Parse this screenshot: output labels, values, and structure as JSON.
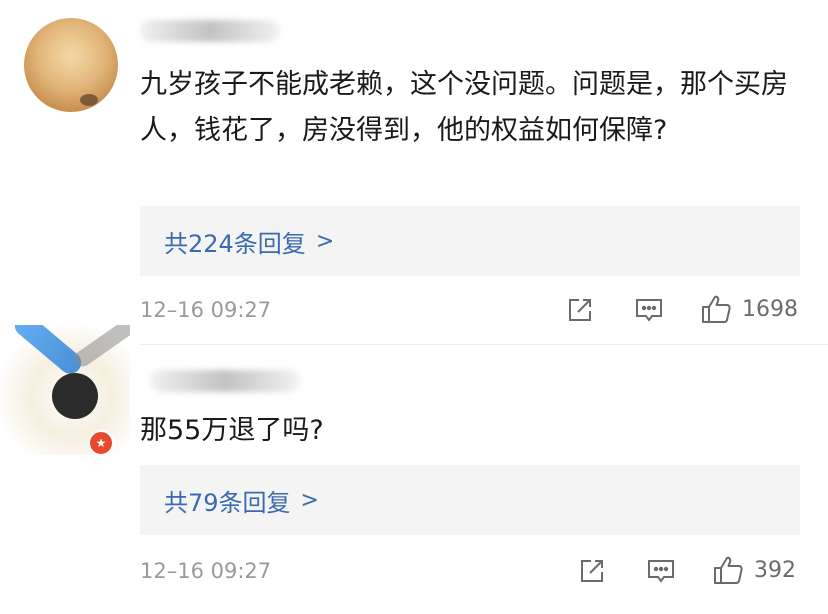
{
  "comments": [
    {
      "text": "九岁孩子不能成老赖，这个没问题。问题是，那个买房人，钱花了，房没得到，他的权益如何保障?",
      "replies_label": "共224条回复",
      "replies_chevron": ">",
      "timestamp": "12–16 09:27",
      "likes": "1698"
    },
    {
      "text": "那55万退了吗?",
      "replies_label": "共79条回复",
      "replies_chevron": ">",
      "timestamp": "12–16 09:27",
      "likes": "392"
    }
  ],
  "icons": {
    "share": "share-icon",
    "reply": "comment-icon",
    "like": "thumbs-up-icon",
    "badge": "verified-badge-icon"
  },
  "colors": {
    "link": "#3a6ab0",
    "reply_bg": "#f4f4f4",
    "meta": "#9a9a9a",
    "badge": "#e8492d"
  }
}
